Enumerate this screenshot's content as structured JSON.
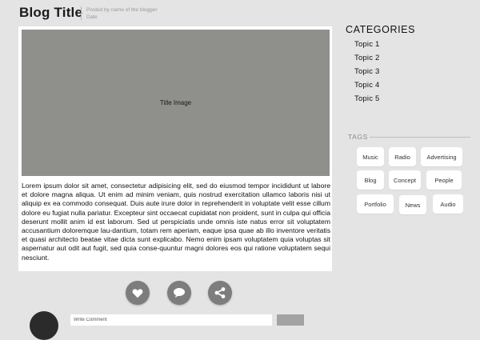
{
  "header": {
    "title": "Blog Title",
    "posted_by": "Posted by name of the blogger",
    "date": "Date"
  },
  "post": {
    "image_label": "Title Image",
    "body": "Lorem ipsum dolor sit amet, consectetur adipisicing elit, sed do eiusmod tempor incididunt ut labore et dolore magna aliqua. Ut enim ad minim veniam, quis nostrud exercitation ullamco laboris nisi ut aliquip ex ea commodo consequat. Duis aute irure dolor in reprehenderit in voluptate velit esse cillum dolore eu fugiat nulla pariatur. Excepteur sint occaecat cupidatat non proident, sunt in culpa qui officia deserunt mollit anim id est laborum. Sed ut perspiciatis unde omnis iste natus error sit voluptatem accusantium doloremque lau-dantium, totam rem aperiam, eaque ipsa quae ab illo inventore veritatis et quasi architecto beatae vitae dicta sunt explicabo. Nemo enim ipsam voluptatem quia voluptas sit aspernatur aut odit aut fugit, sed quia conse-quuntur magni dolores eos qui ratione voluptatem sequi nesciunt."
  },
  "actions": {
    "like_icon": "heart-icon",
    "comment_icon": "speech-bubble-icon",
    "share_icon": "share-icon"
  },
  "comment": {
    "placeholder": "Write Comment"
  },
  "sidebar": {
    "categories_heading": "CATEGORIES",
    "categories": [
      "Topic 1",
      "Topic 2",
      "Topic 3",
      "Topic 4",
      "Topic 5"
    ],
    "tags_heading": "TAGS",
    "tags": [
      "Music",
      "Radio",
      "Advertising",
      "Blog",
      "Concept",
      "People",
      "Portfolio",
      "News",
      "Audio"
    ]
  },
  "colors": {
    "background": "#e4e4e4",
    "card": "#ffffff",
    "image_placeholder": "#8f908b",
    "action_button": "#7d7d7d",
    "avatar": "#2b2b2b",
    "submit_button": "#a3a3a3"
  }
}
